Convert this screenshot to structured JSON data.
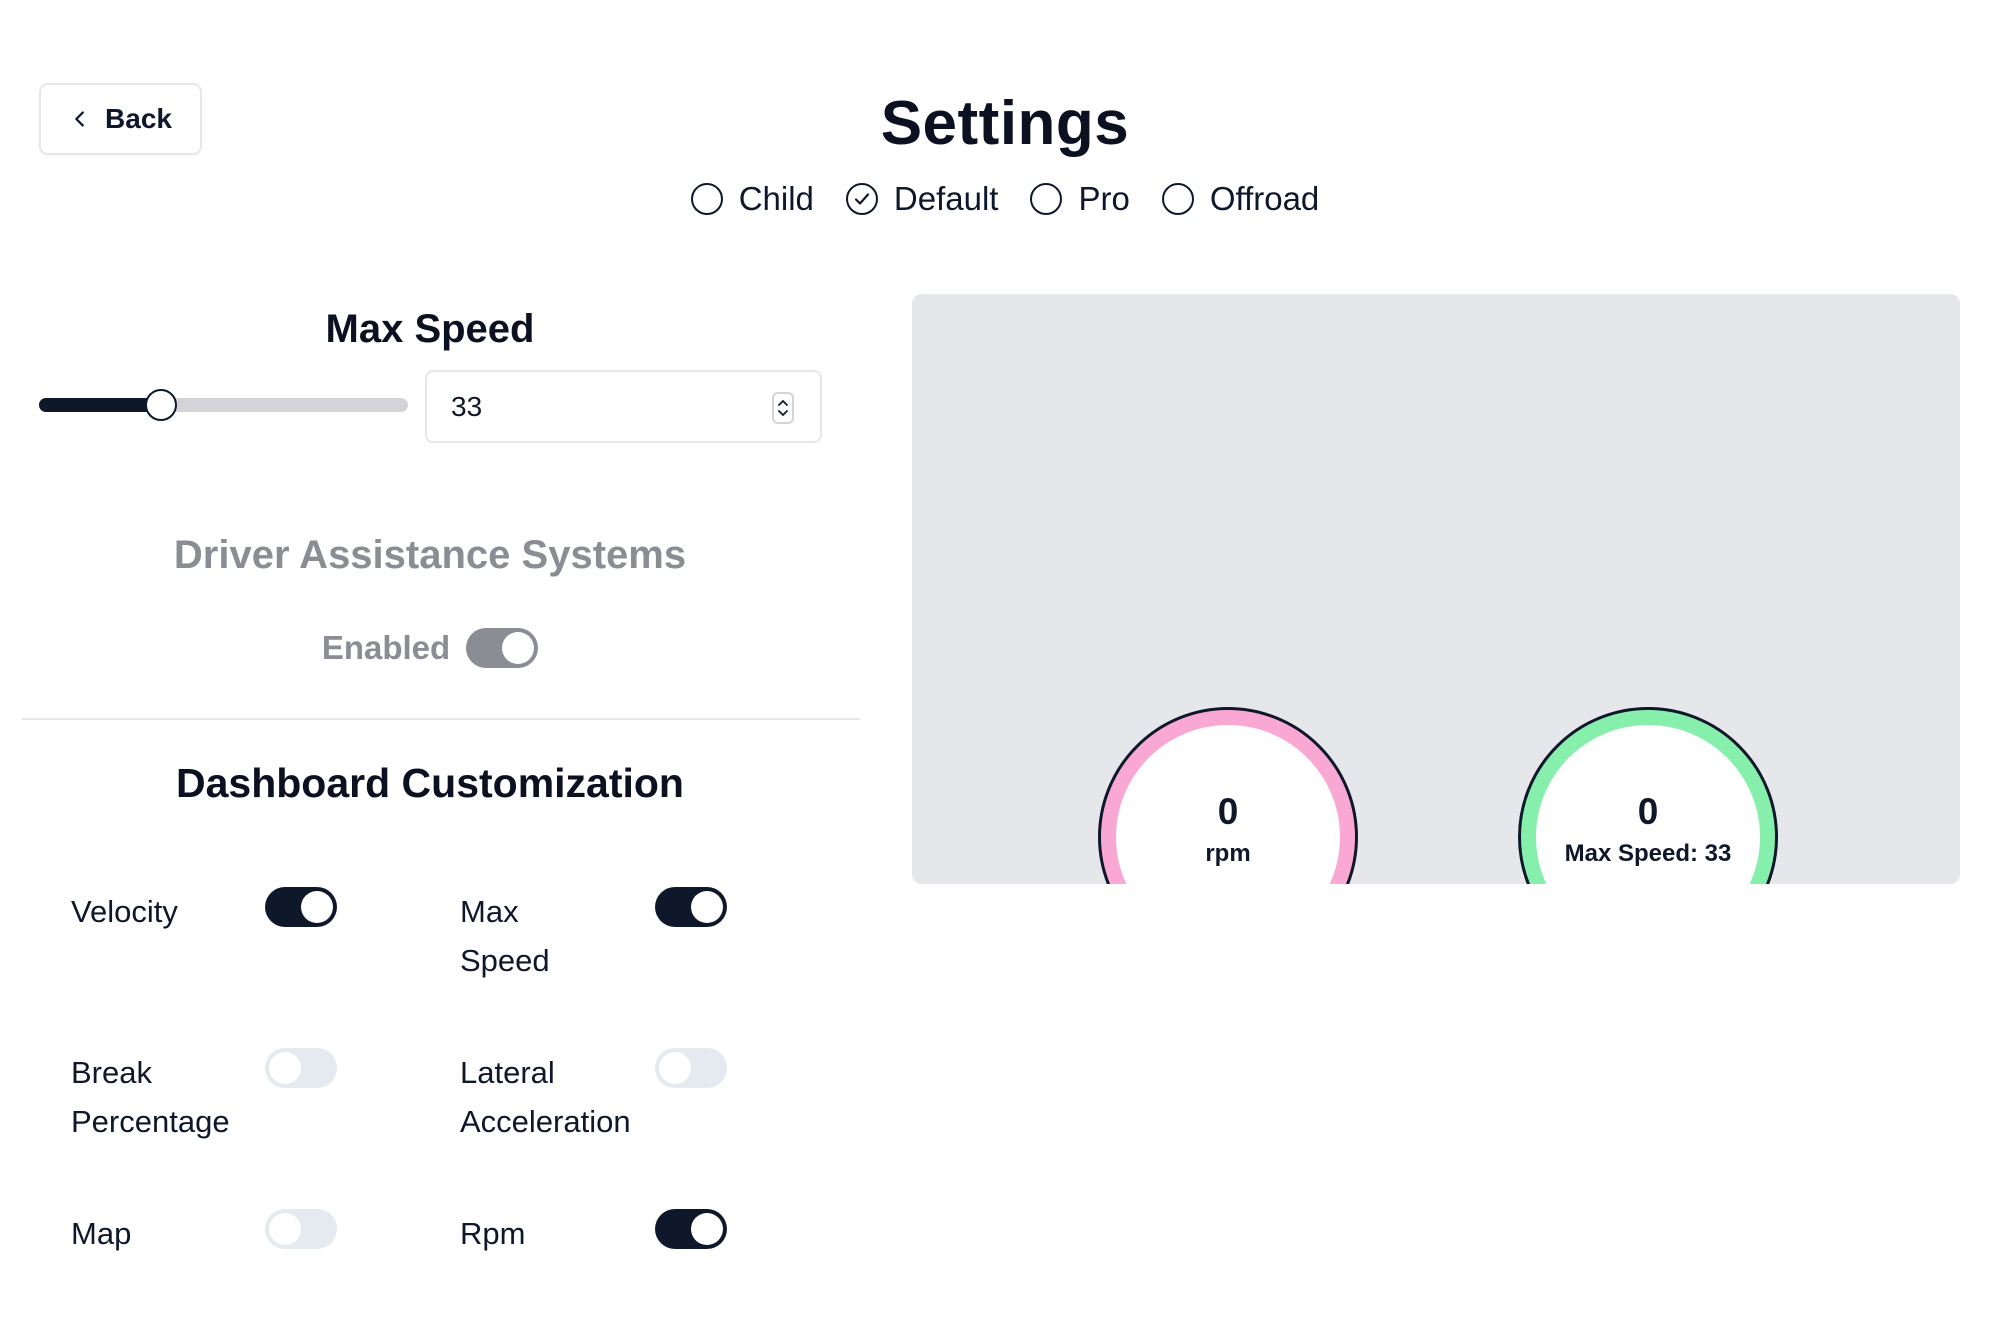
{
  "header": {
    "back_label": "Back",
    "title": "Settings"
  },
  "profiles": {
    "options": [
      {
        "label": "Child",
        "selected": false
      },
      {
        "label": "Default",
        "selected": true
      },
      {
        "label": "Pro",
        "selected": false
      },
      {
        "label": "Offroad",
        "selected": false
      }
    ]
  },
  "max_speed": {
    "title": "Max Speed",
    "value": "33",
    "slider_fraction": 0.33
  },
  "driver_assistance": {
    "title": "Driver Assistance Systems",
    "enabled_label": "Enabled",
    "enabled": true
  },
  "dashboard": {
    "title": "Dashboard Customization",
    "items": [
      {
        "label": "Velocity",
        "on": true
      },
      {
        "label": "Max Speed",
        "on": true
      },
      {
        "label": "Break Percentage",
        "on": false
      },
      {
        "label": "Lateral Acceleration",
        "on": false
      },
      {
        "label": "Map",
        "on": false
      },
      {
        "label": "Rpm",
        "on": true
      }
    ]
  },
  "preview": {
    "rpm_gauge": {
      "value": "0",
      "label": "rpm",
      "ring_color": "#f9a8d4"
    },
    "speed_gauge": {
      "value": "0",
      "label": "Max Speed: 33",
      "ring_color": "#86efac"
    }
  },
  "colors": {
    "primary": "#0f172a",
    "muted": "#8a8d94",
    "toggle_off": "#e5e9f0",
    "panel_bg": "#e5e7eb"
  }
}
